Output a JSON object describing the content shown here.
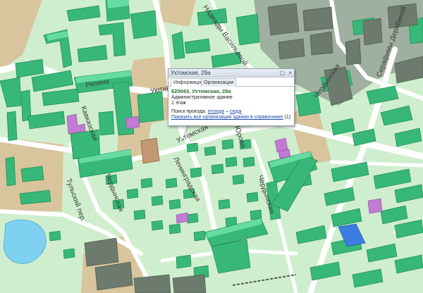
{
  "map": {
    "colors": {
      "background": "#cfeecd",
      "road": "#ffffff",
      "industrial": "#d9c59d",
      "water": "#7fd1f1",
      "residential_building": "#37b878",
      "residential_roof": "#66dca2",
      "admin_building": "#c39872",
      "school_building": "#c07bd2",
      "grey_building": "#6d7b6e",
      "blue_building": "#3d7de0"
    },
    "street_labels": [
      "Репина",
      "Уютная",
      "Кавказская",
      "Ухтомская",
      "Чердынская",
      "Ленинградская",
      "Чердынская",
      "Тульский пер.",
      "Надежды Васильевой",
      "Серафимы Дерябиной",
      "Чердынская",
      "Юрова"
    ]
  },
  "popup": {
    "title": "Ухтомская, 29а",
    "tabs": [
      "Информация",
      "Организации"
    ],
    "active_tab": "Информация",
    "address": "620043, Ухтомская, 29а",
    "building_type": "Административное здание",
    "floors": "1 этаж",
    "route_label": "Поиск проезда:",
    "route_from": "отсюда",
    "route_sep": "–",
    "route_to": "сюда",
    "orgs_link": "Показать все организации здания в справочнике",
    "orgs_count": "(1)",
    "controls": {
      "minimize_icon": "minimize-icon",
      "close_icon": "close-icon"
    }
  }
}
